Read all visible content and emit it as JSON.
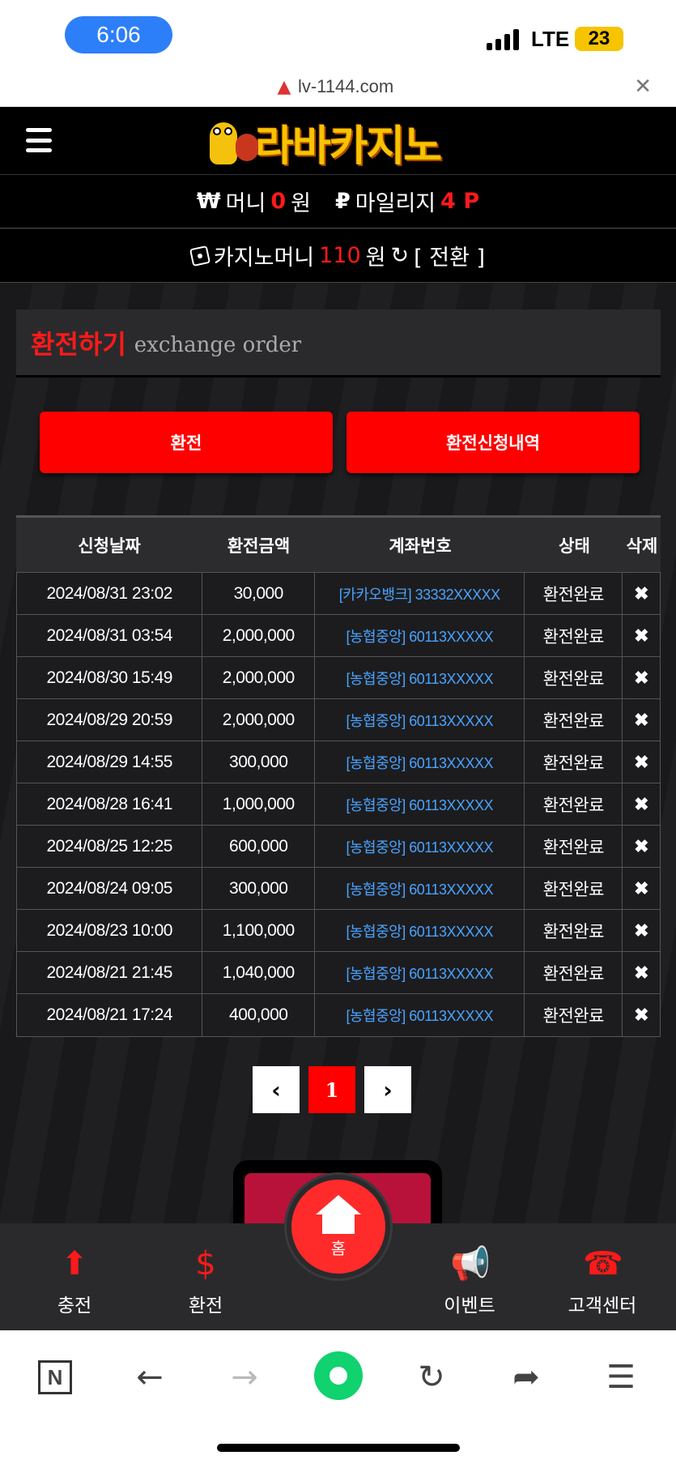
{
  "status_bar": {
    "time": "6:06",
    "network": "LTE",
    "battery": "23"
  },
  "url_bar": {
    "domain": "lv-1144.com"
  },
  "header": {
    "logo_text": "라바카지노"
  },
  "wallet": {
    "money_symbol": "₩",
    "money_label": "머니",
    "money_value": "0",
    "money_unit": "원",
    "mileage_symbol": "₽",
    "mileage_label": "마일리지",
    "mileage_value": "4 P",
    "casino_label": "카지노머니",
    "casino_value": "110",
    "casino_unit": "원",
    "convert_label": "[ 전환 ]"
  },
  "page": {
    "title_ko": "환전하기",
    "title_en": "exchange order"
  },
  "buttons": {
    "exchange": "환전",
    "history": "환전신청내역"
  },
  "table": {
    "headers": [
      "신청날짜",
      "환전금액",
      "계좌번호",
      "상태",
      "삭제"
    ],
    "rows": [
      {
        "date": "2024/08/31 23:02",
        "amount": "30,000",
        "account": "[카카오뱅크] 33332XXXXX",
        "status": "환전완료",
        "delete": "✖"
      },
      {
        "date": "2024/08/31 03:54",
        "amount": "2,000,000",
        "account": "[농협중앙] 60113XXXXX",
        "status": "환전완료",
        "delete": "✖"
      },
      {
        "date": "2024/08/30 15:49",
        "amount": "2,000,000",
        "account": "[농협중앙] 60113XXXXX",
        "status": "환전완료",
        "delete": "✖"
      },
      {
        "date": "2024/08/29 20:59",
        "amount": "2,000,000",
        "account": "[농협중앙] 60113XXXXX",
        "status": "환전완료",
        "delete": "✖"
      },
      {
        "date": "2024/08/29 14:55",
        "amount": "300,000",
        "account": "[농협중앙] 60113XXXXX",
        "status": "환전완료",
        "delete": "✖"
      },
      {
        "date": "2024/08/28 16:41",
        "amount": "1,000,000",
        "account": "[농협중앙] 60113XXXXX",
        "status": "환전완료",
        "delete": "✖"
      },
      {
        "date": "2024/08/25 12:25",
        "amount": "600,000",
        "account": "[농협중앙] 60113XXXXX",
        "status": "환전완료",
        "delete": "✖"
      },
      {
        "date": "2024/08/24 09:05",
        "amount": "300,000",
        "account": "[농협중앙] 60113XXXXX",
        "status": "환전완료",
        "delete": "✖"
      },
      {
        "date": "2024/08/23 10:00",
        "amount": "1,100,000",
        "account": "[농협중앙] 60113XXXXX",
        "status": "환전완료",
        "delete": "✖"
      },
      {
        "date": "2024/08/21 21:45",
        "amount": "1,040,000",
        "account": "[농협중앙] 60113XXXXX",
        "status": "환전완료",
        "delete": "✖"
      },
      {
        "date": "2024/08/21 17:24",
        "amount": "400,000",
        "account": "[농협중앙] 60113XXXXX",
        "status": "환전완료",
        "delete": "✖"
      }
    ]
  },
  "pagination": {
    "prev": "‹",
    "current": "1",
    "next": "›"
  },
  "bottom_nav": {
    "charge": "충전",
    "exchange": "환전",
    "home": "홈",
    "event": "이벤트",
    "support": "고객센터"
  },
  "colors": {
    "accent": "#ff0000",
    "link": "#4aa3ff",
    "background": "#1b1b1d"
  }
}
